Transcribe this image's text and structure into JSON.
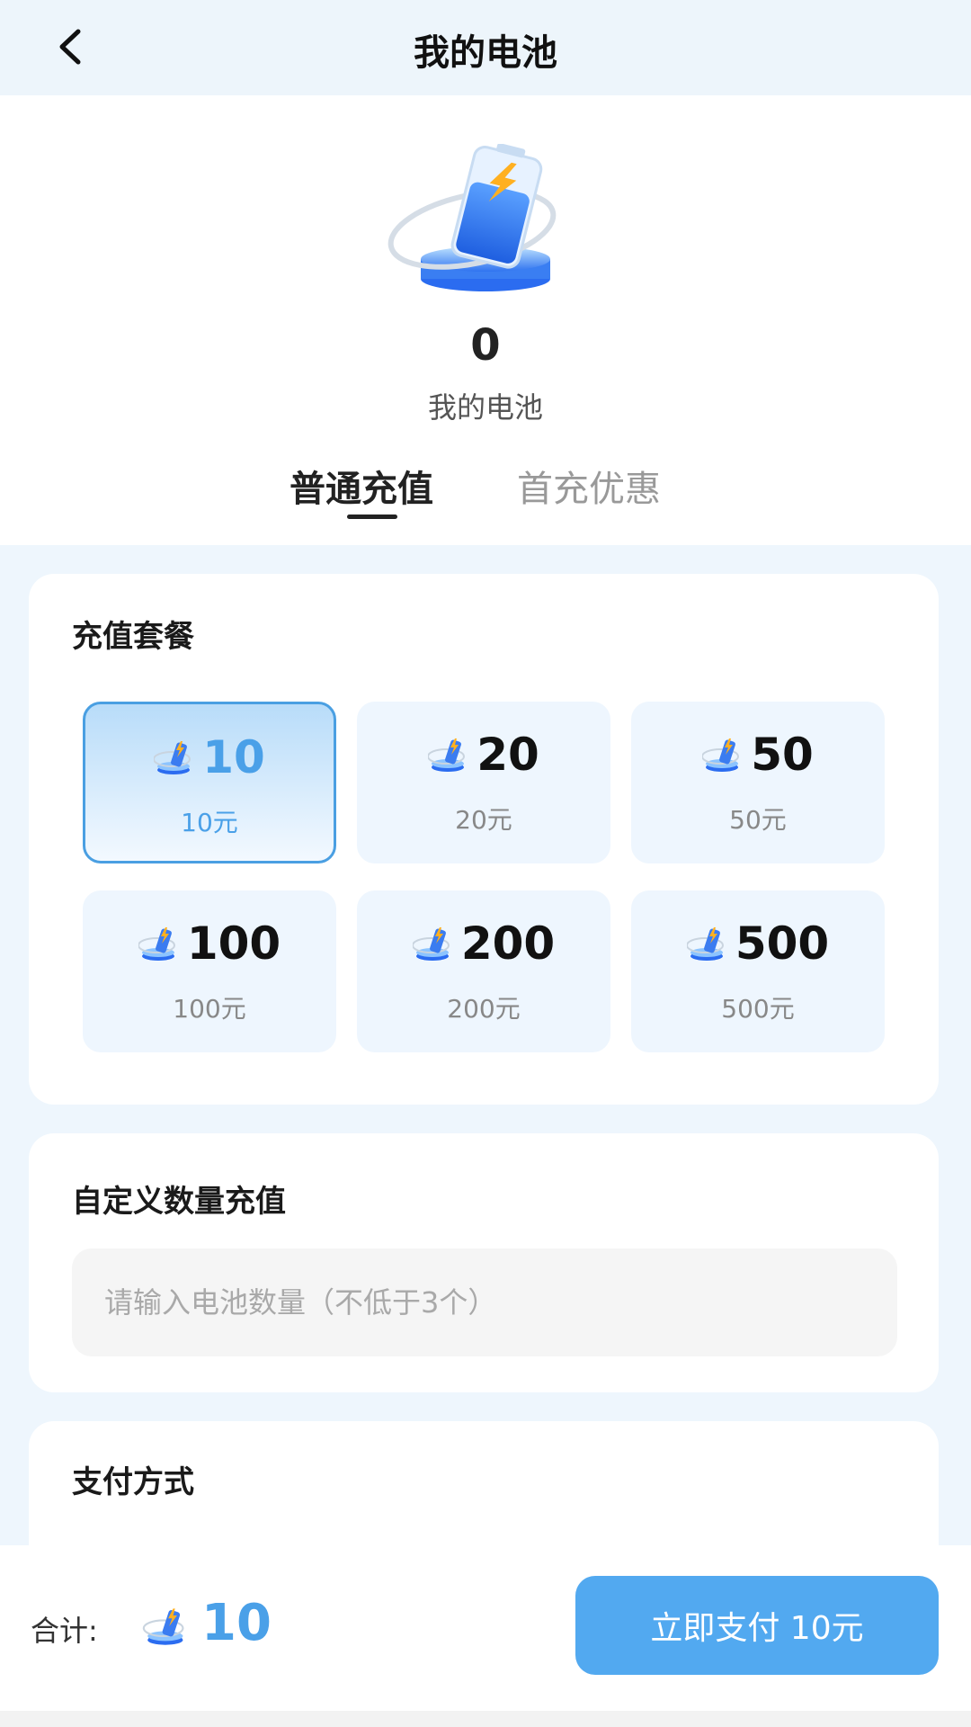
{
  "nav": {
    "title": "我的电池",
    "back_icon": "chevron-left-icon"
  },
  "balance": {
    "value": "0",
    "label": "我的电池",
    "hero_icon": "battery-charging-icon"
  },
  "tabs": [
    {
      "label": "普通充值",
      "active": true
    },
    {
      "label": "首充优惠",
      "active": false
    }
  ],
  "packages": {
    "title": "充值套餐",
    "icon": "battery-coin-icon",
    "selected_index": 0,
    "items": [
      {
        "amount": "10",
        "price": "10元"
      },
      {
        "amount": "20",
        "price": "20元"
      },
      {
        "amount": "50",
        "price": "50元"
      },
      {
        "amount": "100",
        "price": "100元"
      },
      {
        "amount": "200",
        "price": "200元"
      },
      {
        "amount": "500",
        "price": "500元"
      }
    ]
  },
  "custom": {
    "title": "自定义数量充值",
    "placeholder": "请输入电池数量（不低于3个）",
    "value": ""
  },
  "payment": {
    "title": "支付方式"
  },
  "footer": {
    "total_label": "合计:",
    "total_value": "10",
    "pay_button": "立即支付 10元"
  },
  "colors": {
    "accent": "#4aa0e8",
    "button": "#52a9f0",
    "background": "#eef6fd"
  }
}
